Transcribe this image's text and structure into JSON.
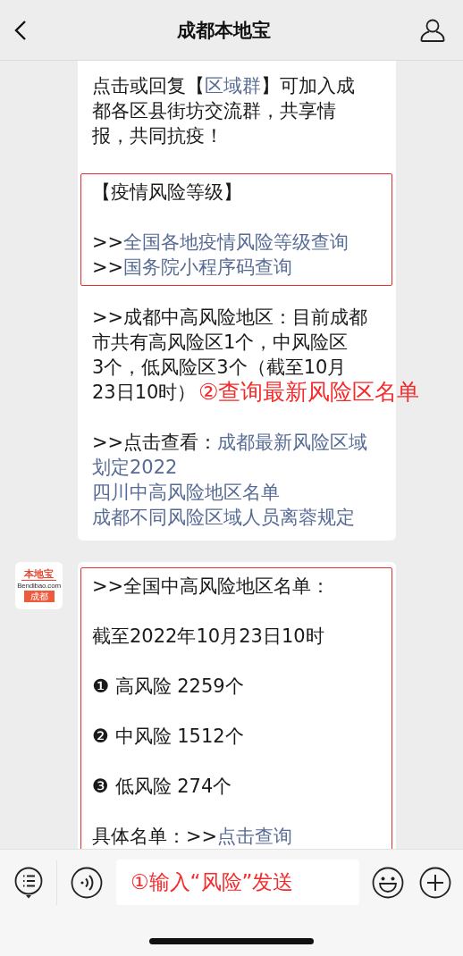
{
  "header": {
    "title": "成都本地宝"
  },
  "messages": [
    {
      "annotation": "②查询最新风险区名单",
      "blocks": [
        {
          "boxed": false,
          "paragraphs": [
            {
              "lines": [
                [
                  {
                    "kind": "text",
                    "text": "点击或回复【"
                  },
                  {
                    "kind": "link",
                    "text": "区域群"
                  },
                  {
                    "kind": "text",
                    "text": "】可加入成"
                  }
                ],
                [
                  {
                    "kind": "text",
                    "text": "都各区县街坊交流群，共享情"
                  }
                ],
                [
                  {
                    "kind": "text",
                    "text": "报，共同抗疫！"
                  }
                ]
              ]
            }
          ]
        },
        {
          "boxed": true,
          "paragraphs": [
            {
              "lines": [
                [
                  {
                    "kind": "text",
                    "text": "【疫情风险等级】"
                  }
                ]
              ]
            },
            {
              "lines": [
                [
                  {
                    "kind": "text",
                    "text": ">>"
                  },
                  {
                    "kind": "link",
                    "text": "全国各地疫情风险等级查询"
                  }
                ],
                [
                  {
                    "kind": "text",
                    "text": ">>"
                  },
                  {
                    "kind": "link",
                    "text": "国务院小程序码查询"
                  }
                ]
              ]
            }
          ]
        },
        {
          "boxed": false,
          "paragraphs": [
            {
              "lines": [
                [
                  {
                    "kind": "text",
                    "text": ">>成都中高风险地区：目前成都"
                  }
                ],
                [
                  {
                    "kind": "text",
                    "text": "市共有高风险区1个，中风险区"
                  }
                ],
                [
                  {
                    "kind": "text",
                    "text": "3个，低风险区3个（截至10月"
                  }
                ],
                [
                  {
                    "kind": "text",
                    "text": "23日10时）"
                  }
                ]
              ]
            },
            {
              "lines": [
                [
                  {
                    "kind": "text",
                    "text": ">>点击查看："
                  },
                  {
                    "kind": "link",
                    "text": "成都最新风险区域"
                  }
                ],
                [
                  {
                    "kind": "link",
                    "text": "划定2022"
                  }
                ],
                [
                  {
                    "kind": "link",
                    "text": "四川中高风险地区名单"
                  }
                ],
                [
                  {
                    "kind": "link",
                    "text": "成都不同风险区域人员离蓉规定"
                  }
                ]
              ]
            }
          ]
        }
      ]
    },
    {
      "avatar": {
        "brand": "本地宝",
        "domain": "Bendibao.com",
        "city": "成都"
      },
      "blocks": [
        {
          "boxed": true,
          "paragraphs": [
            {
              "lines": [
                [
                  {
                    "kind": "text",
                    "text": ">>全国中高风险地区名单："
                  }
                ]
              ]
            },
            {
              "lines": [
                [
                  {
                    "kind": "text",
                    "text": "截至2022年10月23日10时"
                  }
                ]
              ]
            },
            {
              "lines": [
                [
                  {
                    "kind": "text",
                    "text": "❶ 高风险 2259个"
                  }
                ]
              ]
            },
            {
              "lines": [
                [
                  {
                    "kind": "text",
                    "text": "❷ 中风险 1512个"
                  }
                ]
              ]
            },
            {
              "lines": [
                [
                  {
                    "kind": "text",
                    "text": "❸ 低风险 274个"
                  }
                ]
              ]
            },
            {
              "lines": [
                [
                  {
                    "kind": "text",
                    "text": "具体名单：>>"
                  },
                  {
                    "kind": "link",
                    "text": "点击查询"
                  }
                ]
              ]
            }
          ]
        }
      ]
    }
  ],
  "input_field": {
    "value": "①输入“风险”发送"
  }
}
